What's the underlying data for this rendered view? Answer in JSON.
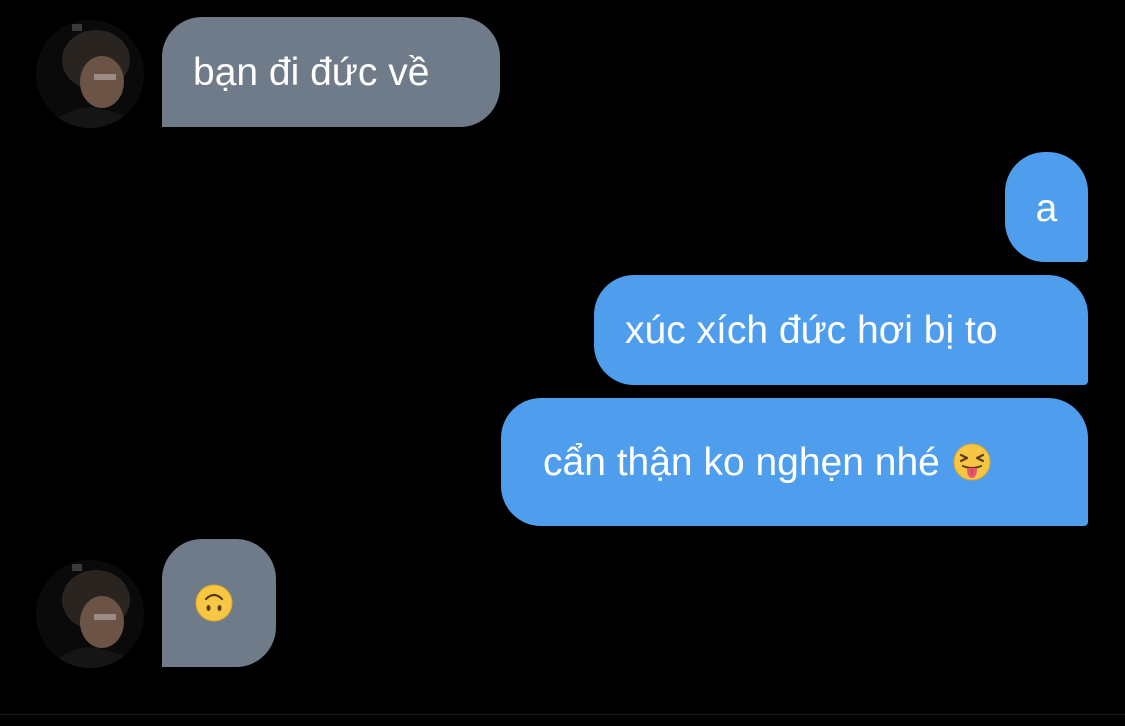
{
  "conversation": {
    "messages": [
      {
        "sender": "other",
        "text": "bạn đi đức về",
        "emoji": ""
      },
      {
        "sender": "me",
        "text": "a",
        "emoji": ""
      },
      {
        "sender": "me",
        "text": "xúc xích đức hơi bị to",
        "emoji": ""
      },
      {
        "sender": "me",
        "text": "cẩn thận ko nghẹn nhé",
        "emoji": "squinting-face-with-tongue-icon"
      },
      {
        "sender": "other",
        "text": "",
        "emoji": "upside-down-face-icon"
      }
    ]
  },
  "colors": {
    "background": "#000000",
    "incoming_bubble": "#6f7b88",
    "outgoing_bubble": "#4f9ded",
    "text": "#ffffff"
  }
}
